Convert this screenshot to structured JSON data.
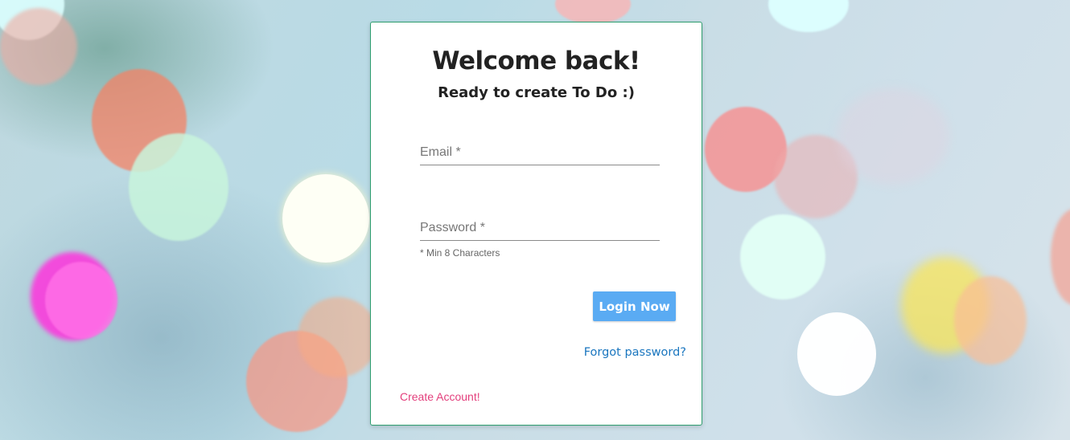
{
  "login": {
    "title": "Welcome back!",
    "subtitle": "Ready to create To Do :)",
    "email_placeholder": "Email *",
    "email_value": "",
    "password_placeholder": "Password *",
    "password_value": "",
    "password_hint": "* Min 8 Characters",
    "login_button": "Login Now",
    "forgot_link": "Forgot password?",
    "create_link": "Create Account!"
  },
  "colors": {
    "card_border": "#2e9e6f",
    "button": "#5aabf3",
    "forgot_link": "#1a76bf",
    "create_link": "#e33f7c"
  }
}
